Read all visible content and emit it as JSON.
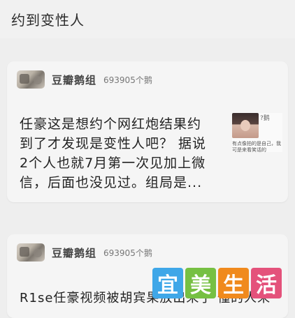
{
  "page": {
    "title": "约到变性人"
  },
  "posts": [
    {
      "group_name": "豆瓣鹅组",
      "member_count": "693905个鹅",
      "title": "任豪这是想约个网红炮结果约到了才发现是变性人吧？ 据说2个人也就7月第一次见加上微信，后面也没见过。组局是...",
      "thumbnail": {
        "badge": "?鹅",
        "caption": "有点像拍的是自己，我可是来看笑话的"
      }
    },
    {
      "group_name": "豆瓣鹅组",
      "member_count": "693905个鹅",
      "title": "R1se任豪视频被胡宾果放出来了 懂的人来"
    }
  ],
  "watermark": {
    "chars": [
      "宜",
      "美",
      "生",
      "活"
    ]
  }
}
